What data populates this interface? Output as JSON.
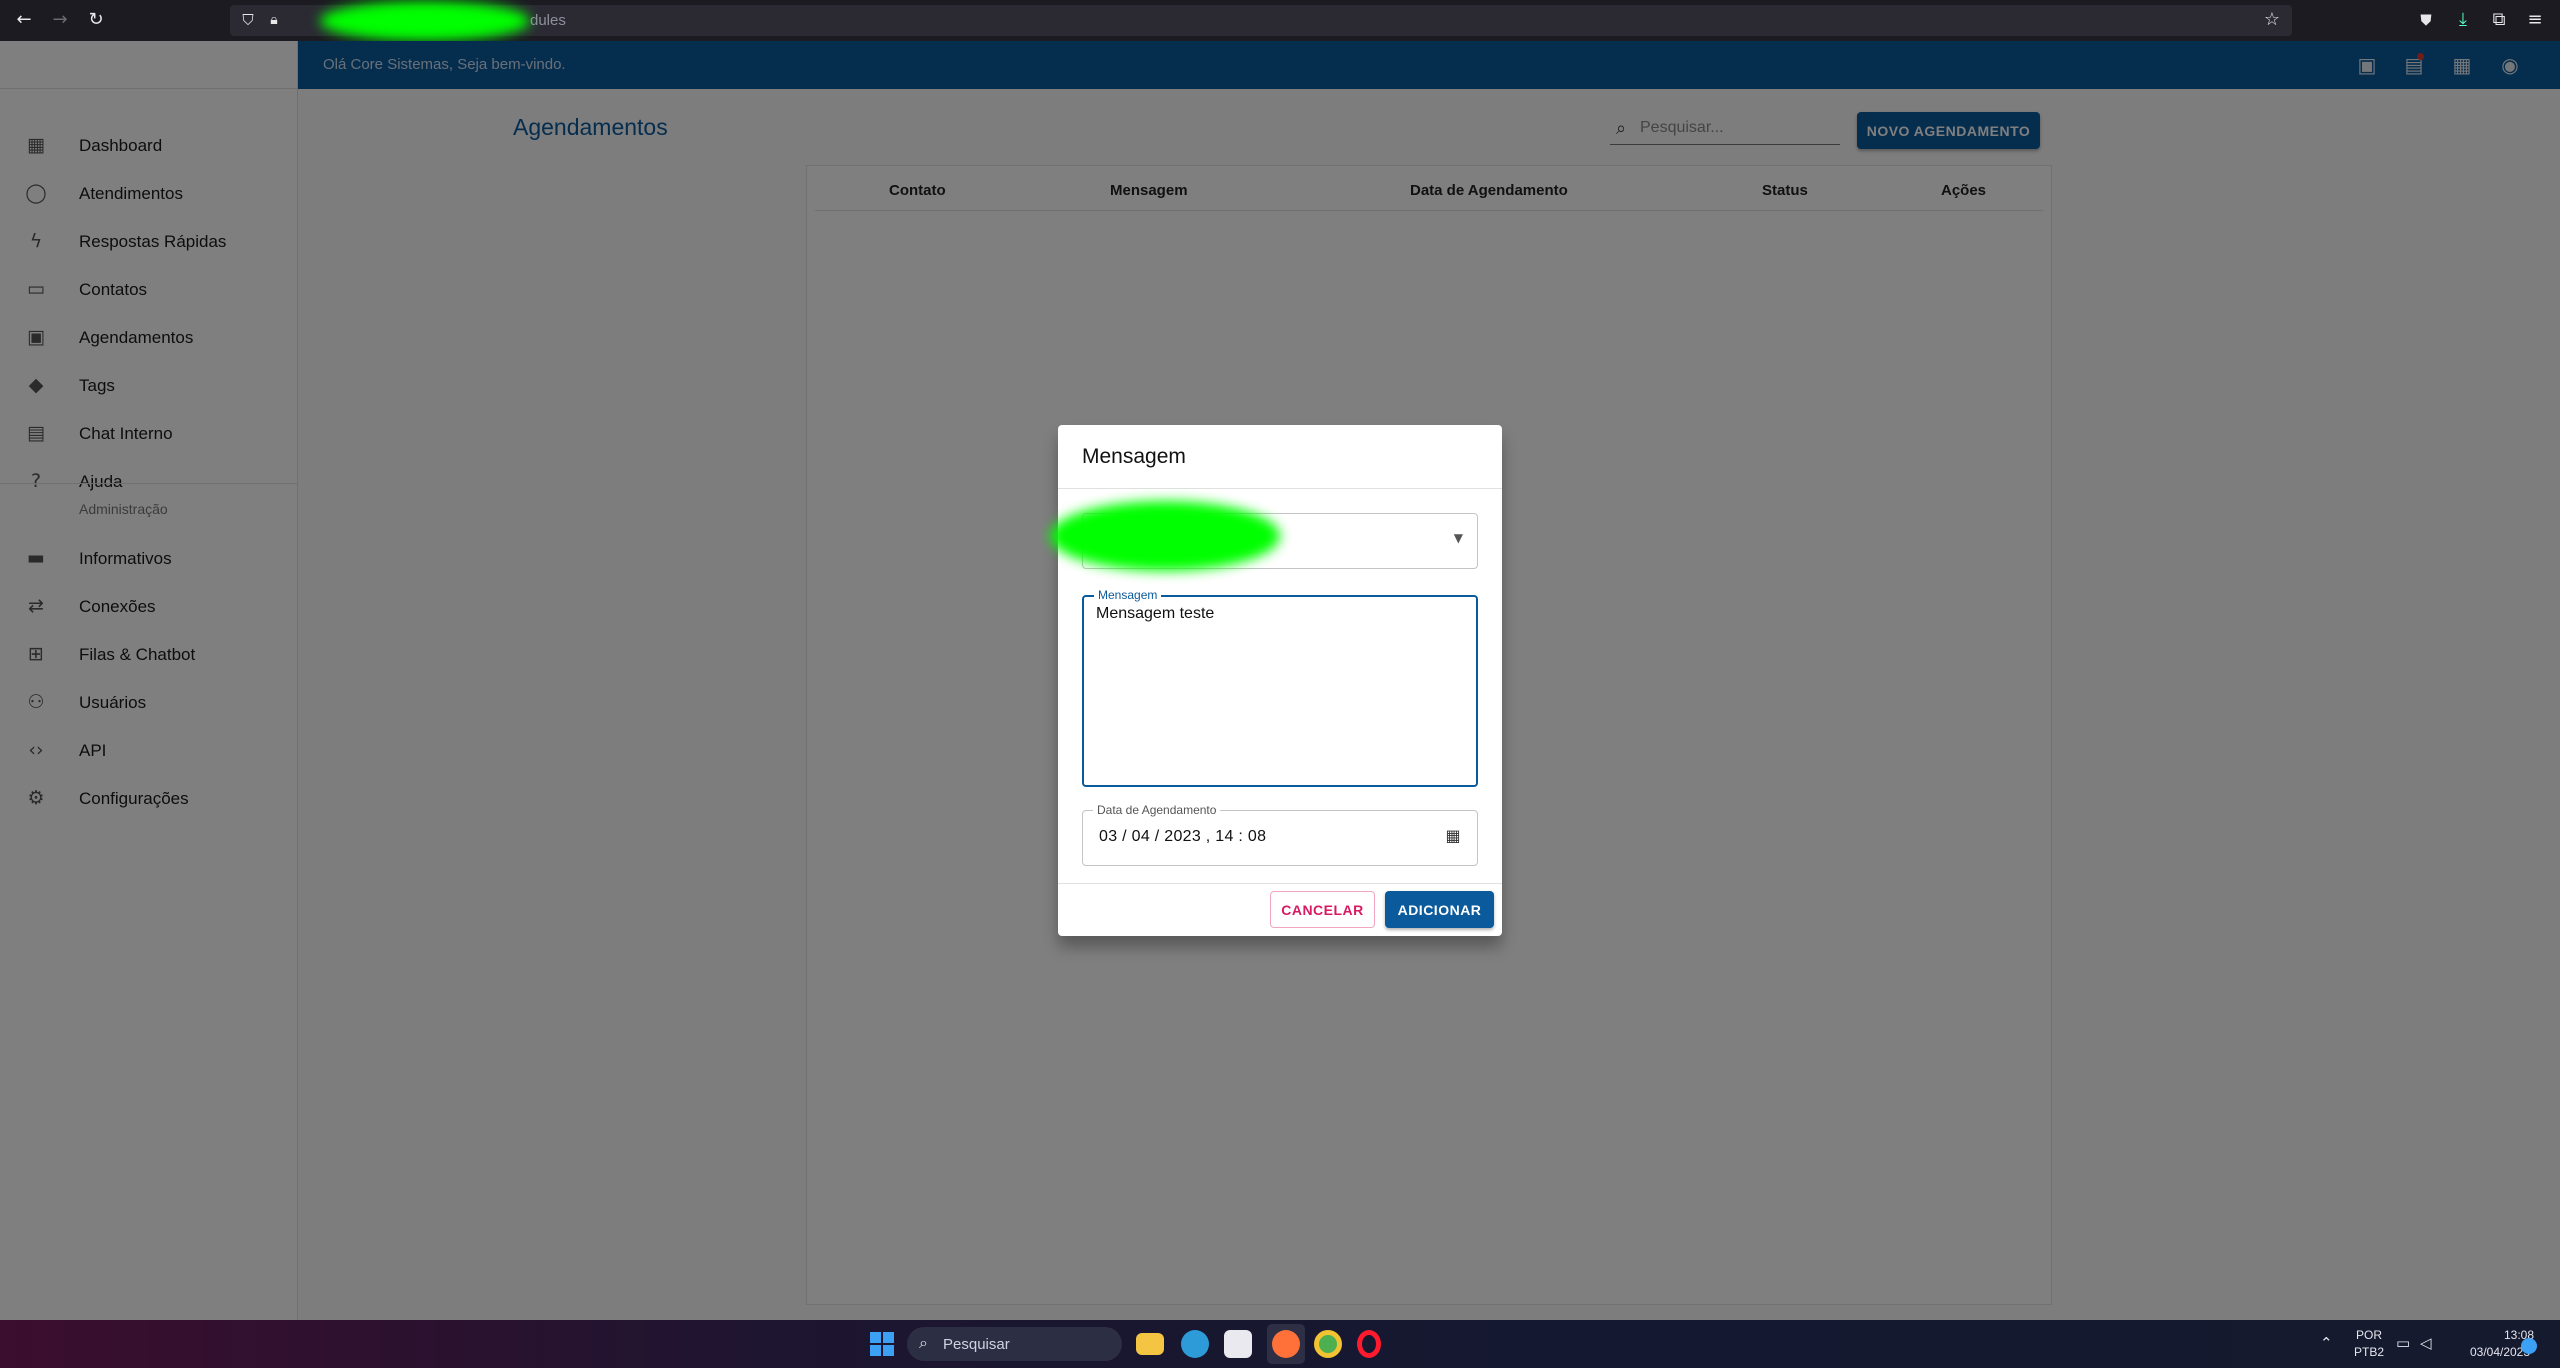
{
  "browser": {
    "url_text": "dules"
  },
  "header": {
    "welcome": "Olá Core Sistemas, Seja bem-vindo."
  },
  "sidebar": {
    "items": [
      {
        "label": "Dashboard",
        "icon": "dashboard-icon"
      },
      {
        "label": "Atendimentos",
        "icon": "whatsapp-icon"
      },
      {
        "label": "Respostas Rápidas",
        "icon": "flash-icon"
      },
      {
        "label": "Contatos",
        "icon": "contacts-icon"
      },
      {
        "label": "Agendamentos",
        "icon": "calendar-icon"
      },
      {
        "label": "Tags",
        "icon": "tag-icon"
      },
      {
        "label": "Chat Interno",
        "icon": "forum-icon"
      },
      {
        "label": "Ajuda",
        "icon": "help-icon"
      }
    ],
    "section_title": "Administração",
    "admin_items": [
      {
        "label": "Informativos",
        "icon": "announcement-icon"
      },
      {
        "label": "Conexões",
        "icon": "sync-alt-icon"
      },
      {
        "label": "Filas & Chatbot",
        "icon": "account-tree-icon"
      },
      {
        "label": "Usuários",
        "icon": "people-icon"
      },
      {
        "label": "API",
        "icon": "code-icon"
      },
      {
        "label": "Configurações",
        "icon": "settings-icon"
      }
    ]
  },
  "main": {
    "title": "Agendamentos",
    "search_placeholder": "Pesquisar...",
    "new_button": "NOVO AGENDAMENTO",
    "columns": [
      "Contato",
      "Mensagem",
      "Data de Agendamento",
      "Status",
      "Ações"
    ]
  },
  "dialog": {
    "title": "Mensagem",
    "message_label": "Mensagem",
    "message_value": "Mensagem teste",
    "date_label": "Data de Agendamento",
    "date_value": "03 / 04 / 2023 ,  14 : 08",
    "cancel": "CANCELAR",
    "add": "ADICIONAR"
  },
  "taskbar": {
    "search_label": "Pesquisar",
    "lang_top": "POR",
    "lang_bottom": "PTB2",
    "time": "13:08",
    "date": "03/04/2023"
  },
  "colors": {
    "primary": "#0b5a9c",
    "danger": "#d81b60"
  }
}
